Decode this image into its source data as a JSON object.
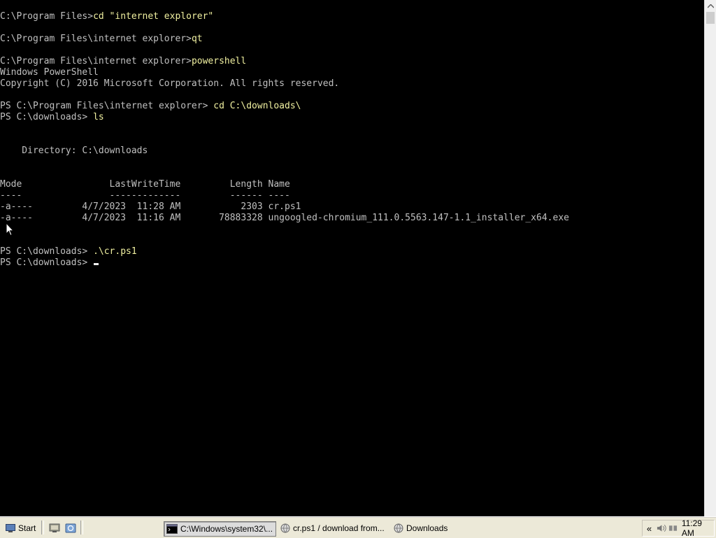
{
  "console": {
    "lines": [
      {
        "prompt": "C:\\Program Files>",
        "command": "cd \"internet explorer\""
      },
      {
        "text": ""
      },
      {
        "prompt": "C:\\Program Files\\internet explorer>",
        "command": "qt"
      },
      {
        "text": ""
      },
      {
        "prompt": "C:\\Program Files\\internet explorer>",
        "command": "powershell"
      },
      {
        "text": "Windows PowerShell"
      },
      {
        "text": "Copyright (C) 2016 Microsoft Corporation. All rights reserved."
      },
      {
        "text": ""
      },
      {
        "prompt": "PS C:\\Program Files\\internet explorer> ",
        "command": "cd C:\\downloads\\"
      },
      {
        "prompt": "PS C:\\downloads> ",
        "command": "ls"
      },
      {
        "text": ""
      },
      {
        "text": ""
      },
      {
        "text": "    Directory: C:\\downloads"
      },
      {
        "text": ""
      },
      {
        "text": ""
      },
      {
        "text": "Mode                LastWriteTime         Length Name"
      },
      {
        "text": "----                -------------         ------ ----"
      },
      {
        "text": "-a----         4/7/2023  11:28 AM           2303 cr.ps1"
      },
      {
        "text": "-a----         4/7/2023  11:16 AM       78883328 ungoogled-chromium_111.0.5563.147-1.1_installer_x64.exe"
      },
      {
        "text": ""
      },
      {
        "text": ""
      },
      {
        "prompt": "PS C:\\downloads> ",
        "command": ".\\cr.ps1"
      },
      {
        "prompt": "PS C:\\downloads> ",
        "command": "",
        "cursor": true
      }
    ],
    "text_color": "#c0c0c0",
    "command_color": "#f0f0a0",
    "background": "#000000"
  },
  "taskbar": {
    "start_label": "Start",
    "tasks": {
      "cmd": "C:\\Windows\\system32\\...",
      "cr": "cr.ps1 / download from...",
      "downloads": "Downloads"
    },
    "tray_chevron": "«",
    "clock": "11:29 AM"
  }
}
